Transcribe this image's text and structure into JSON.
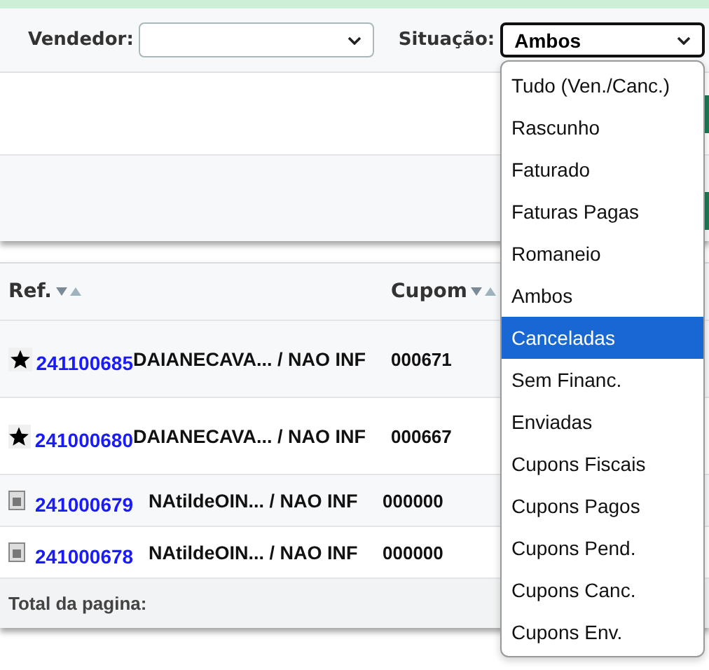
{
  "filters": {
    "vendedor": {
      "label": "Vendedor:"
    },
    "situacao": {
      "label": "Situação:",
      "value": "Ambos"
    }
  },
  "situacao_options": [
    {
      "label": "Tudo (Ven./Canc.)",
      "selected": false
    },
    {
      "label": "Rascunho",
      "selected": false
    },
    {
      "label": "Faturado",
      "selected": false
    },
    {
      "label": "Faturas Pagas",
      "selected": false
    },
    {
      "label": "Romaneio",
      "selected": false
    },
    {
      "label": "Ambos",
      "selected": false
    },
    {
      "label": "Canceladas",
      "selected": true
    },
    {
      "label": "Sem Financ.",
      "selected": false
    },
    {
      "label": "Enviadas",
      "selected": false
    },
    {
      "label": "Cupons Fiscais",
      "selected": false
    },
    {
      "label": "Cupons Pagos",
      "selected": false
    },
    {
      "label": "Cupons Pend.",
      "selected": false
    },
    {
      "label": "Cupons Canc.",
      "selected": false
    },
    {
      "label": "Cupons Env.",
      "selected": false
    }
  ],
  "table": {
    "columns": [
      "Ref.",
      "Cupom"
    ],
    "rows": [
      {
        "kind": "star",
        "ref": "241100685",
        "client": "DAIANECAVA... / NAO INF",
        "cupom": "000671"
      },
      {
        "kind": "star",
        "ref": "241000680",
        "client": "DAIANECAVA... / NAO INF",
        "cupom": "000667"
      },
      {
        "kind": "receipt",
        "ref": "241000679",
        "client": "NAtildeOIN... / NAO INF",
        "cupom": "000000"
      },
      {
        "kind": "receipt",
        "ref": "241000678",
        "client": "NAtildeOIN... / NAO INF",
        "cupom": "000000"
      }
    ],
    "footer": "Total da pagina:"
  }
}
